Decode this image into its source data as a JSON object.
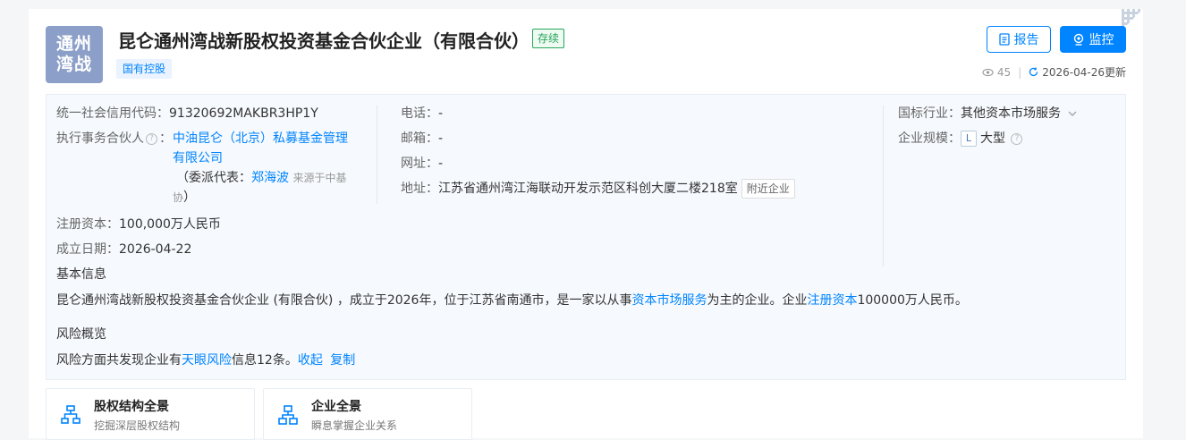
{
  "company": {
    "logo_text": "通州湾战",
    "name": "昆仑通州湾战新股权投资基金合伙企业（有限合伙）",
    "status": "存续",
    "tag": "国有控股"
  },
  "actions": {
    "report_label": "报告",
    "monitor_label": "监控"
  },
  "meta": {
    "views": "45",
    "updated": "2026-04-26更新"
  },
  "info": {
    "credit_code_label": "统一社会信用代码：",
    "credit_code": "91320692MAKBR3HP1Y",
    "partner_label": "执行事务合伙人",
    "partner_colon": "：",
    "partner_line1": "中油昆仑（北京）私募基金管理",
    "partner_line2": "有限公司",
    "delegate_prefix": "（委派代表：",
    "delegate_name": "郑海波",
    "delegate_source_1": "来源于中基",
    "delegate_source_2": "协",
    "delegate_suffix": "）",
    "capital_label": "注册资本：",
    "capital": "100,000万人民币",
    "founded_label": "成立日期：",
    "founded": "2026-04-22",
    "phone_label": "电话：",
    "phone": "-",
    "email_label": "邮箱：",
    "email": "-",
    "website_label": "网址：",
    "website": "-",
    "address_label": "地址：",
    "address": "江苏省通州湾江海联动开发示范区科创大厦二楼218室",
    "nearby_label": "附近企业",
    "industry_label": "国标行业：",
    "industry": "其他资本市场服务",
    "scale_label": "企业规模：",
    "scale_badge": "L",
    "scale": "大型"
  },
  "basic": {
    "title": "基本信息",
    "text_1": "昆仑通州湾战新股权投资基金合伙企业 (有限合伙) ，成立于2026年，位于江苏省南通市，是一家以从事",
    "link_1": "资本市场服务",
    "text_2": "为主的企业。企业",
    "link_2": "注册资本",
    "text_3": "100000万人民币。"
  },
  "risk": {
    "title": "风险概览",
    "text_1": "风险方面共发现企业有",
    "link": "天眼风险",
    "text_2": "信息12条。",
    "collapse": "收起",
    "copy": "复制"
  },
  "features": [
    {
      "title": "股权结构全景",
      "subtitle": "挖掘深层股权结构"
    },
    {
      "title": "企业全景",
      "subtitle": "瞬息掌握企业关系"
    }
  ],
  "colors": {
    "accent": "#0084ff",
    "status_green": "#26a65b",
    "logo_bg": "#8c9fc8"
  }
}
